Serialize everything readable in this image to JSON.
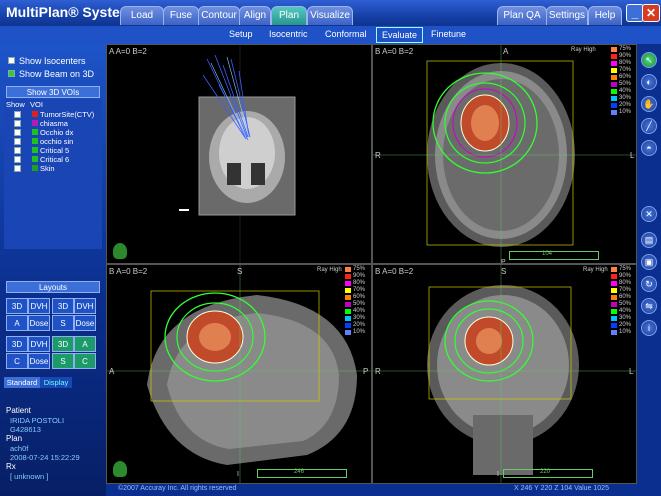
{
  "app": {
    "title": "MultiPlan® System"
  },
  "tabs": [
    {
      "label": "Load"
    },
    {
      "label": "Fuse"
    },
    {
      "label": "Contour"
    },
    {
      "label": "Align"
    },
    {
      "label": "Plan"
    },
    {
      "label": "Visualize"
    }
  ],
  "right_tabs": [
    {
      "label": "Plan QA"
    },
    {
      "label": "Settings"
    },
    {
      "label": "Help"
    }
  ],
  "window": {
    "minimize": "_",
    "close": "✕"
  },
  "subnav": {
    "setup": "Setup",
    "isocentric": "Isocentric",
    "conformal": "Conformal",
    "evaluate": "Evaluate",
    "finetune": "Finetune"
  },
  "left": {
    "show_isocenters": "Show Isocenters",
    "show_beam": "Show Beam on 3D",
    "show_3d_vois": "Show 3D VOIs",
    "voi_headers": {
      "show": "Show",
      "voi": "VOI"
    },
    "vois": [
      {
        "name": "TumorSite(CTV)",
        "color": "#e02020"
      },
      {
        "name": "chiasma",
        "color": "#b020b0"
      },
      {
        "name": "Occhio dx",
        "color": "#20c020"
      },
      {
        "name": "occhio sin",
        "color": "#20c020"
      },
      {
        "name": "Critical 5",
        "color": "#20c020"
      },
      {
        "name": "Critical 6",
        "color": "#20c020"
      },
      {
        "name": "Skin",
        "color": "#20a020"
      }
    ],
    "layouts": "Layouts",
    "layout_grid": [
      [
        "3D",
        "DVH",
        "3D",
        "DVH"
      ],
      [
        "A",
        "Dose",
        "S",
        "Dose"
      ],
      [
        "3D",
        "DVH",
        "3D",
        "A"
      ],
      [
        "C",
        "Dose",
        "S",
        "C"
      ]
    ],
    "tab_standard": "Standard",
    "tab_display": "Display",
    "patient_label": "Patient",
    "patient_name": "IRIDA POSTOLI",
    "patient_id": "G428613",
    "plan_label": "Plan",
    "plan_name": "ach0f",
    "plan_date": "2008-07-24 15:22:29",
    "rx_label": "Rx",
    "rx_value": "[ unknown ]"
  },
  "viewports": {
    "a_label": "A  A=0  B=2",
    "b_label": "B  A=0  B=2",
    "c_label": "B  A=0  B=2",
    "d_label": "B  A=0  B=2",
    "ray_high": "Ray High",
    "orient": {
      "A": "A",
      "R": "R",
      "L": "L",
      "S": "S",
      "I": "I",
      "P": "P"
    },
    "scroll_b": "104",
    "scroll_c": "246",
    "scroll_d": "220"
  },
  "legend": [
    {
      "pct": "75%",
      "color": "#ff8040"
    },
    {
      "pct": "90%",
      "color": "#ff2020"
    },
    {
      "pct": "80%",
      "color": "#ff00ff"
    },
    {
      "pct": "70%",
      "color": "#ffff00"
    },
    {
      "pct": "60%",
      "color": "#ff8000"
    },
    {
      "pct": "50%",
      "color": "#c000c0"
    },
    {
      "pct": "40%",
      "color": "#00ff00"
    },
    {
      "pct": "30%",
      "color": "#00c0ff"
    },
    {
      "pct": "20%",
      "color": "#0040ff"
    },
    {
      "pct": "10%",
      "color": "#6080ff"
    }
  ],
  "status": {
    "copyright": "©2007 Accuray Inc. All rights reserved",
    "coords": "X 246  Y 220  Z 104   Value 1025"
  },
  "tools": [
    "pointer-icon",
    "ellipse-icon",
    "hand-icon",
    "brush-icon",
    "contrast-icon",
    "cross-icon",
    "layers-icon",
    "cube-icon",
    "rotate-icon",
    "flip-icon",
    "info-icon"
  ]
}
